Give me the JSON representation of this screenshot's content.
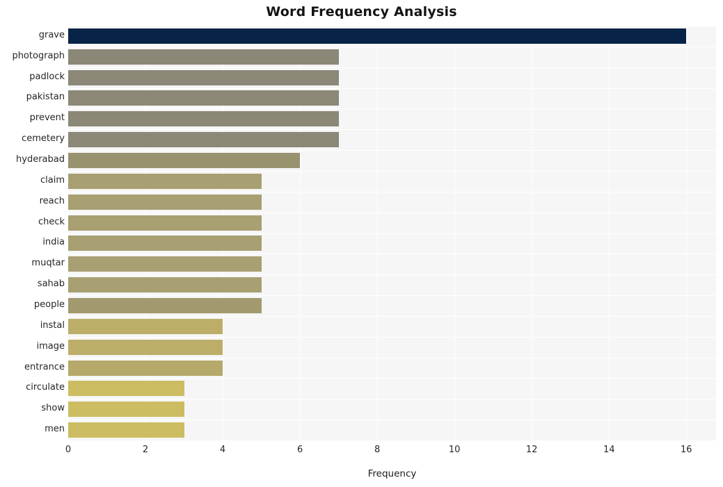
{
  "chart_data": {
    "type": "bar",
    "orientation": "horizontal",
    "title": "Word Frequency Analysis",
    "xlabel": "Frequency",
    "ylabel": "",
    "categories": [
      "grave",
      "photograph",
      "padlock",
      "pakistan",
      "prevent",
      "cemetery",
      "hyderabad",
      "claim",
      "reach",
      "check",
      "india",
      "muqtar",
      "sahab",
      "people",
      "instal",
      "image",
      "entrance",
      "circulate",
      "show",
      "men"
    ],
    "values": [
      16,
      7,
      7,
      7,
      7,
      7,
      6,
      5,
      5,
      5,
      5,
      5,
      5,
      5,
      4,
      4,
      4,
      3,
      3,
      3
    ],
    "bar_colors": [
      "#072347",
      "#8b8878",
      "#8b8878",
      "#8b8878",
      "#8b8878",
      "#8b8878",
      "#99926f",
      "#a89f72",
      "#a89f72",
      "#a89f72",
      "#a89f72",
      "#a89f72",
      "#a89f72",
      "#a2996f",
      "#bcae68",
      "#bcae68",
      "#b5a96b",
      "#ccbc62",
      "#ccbc62",
      "#ccbc62"
    ],
    "xlim": [
      0,
      16.77
    ],
    "xticks": [
      0,
      2,
      4,
      6,
      8,
      10,
      12,
      14,
      16
    ],
    "xtick_labels": [
      "0",
      "2",
      "4",
      "6",
      "8",
      "10",
      "12",
      "14",
      "16"
    ],
    "grid": true,
    "grid_color": "#ffffff",
    "plot_background": "#f6f6f6",
    "figure_background": "#ffffff",
    "legend": null
  }
}
